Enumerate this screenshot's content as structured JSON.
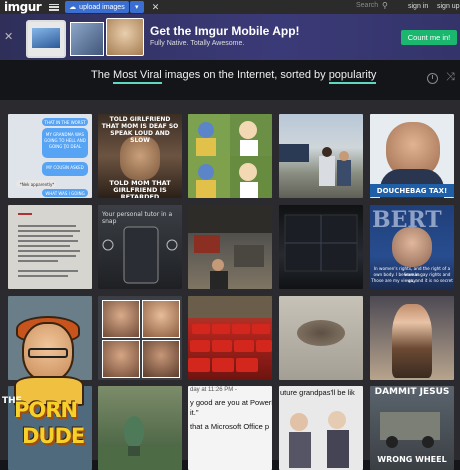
{
  "topbar": {
    "logo": "imgur",
    "upload_label": "upload images",
    "search_label": "Search",
    "signin_label": "sign in",
    "signup_label": "sign up"
  },
  "banner": {
    "title": "Get the Imgur Mobile App!",
    "subtitle": "Fully Native. Totally Awesome.",
    "cta_label": "Count me in!"
  },
  "headline": {
    "prefix": "The",
    "sort_word": "Most Viral",
    "middle": "images on the Internet, sorted by",
    "order_word": "popularity"
  },
  "tiles": {
    "t11_lines": [
      "THAT IN THE WORST",
      "WAY POSSIBLE",
      "MY GRANDMA WAS",
      "SAYING HOW SHE'S",
      "GOING TO HELL AND I",
      "SAID YOU WERE",
      "GOING TO DEAL",
      "WITH IT I STARTED",
      "TO LEAVE",
      "MY COUSIN ASKED",
      "WHERE I WAS GOING",
      "*Nek apparently*",
      "WHAT WAS I GOING"
    ],
    "t12_top": "TOLD GIRLFRIEND THAT MOM IS DEAF SO SPEAK LOUD AND SLOW",
    "t12_bottom": "TOLD MOM THAT GIRLFRIEND IS RETARDED",
    "t15_caption": "DOUCHEBAG TAX!",
    "t22_text": "Your personal tutor in a snap",
    "t25_letters": "BERT",
    "t25_caption_1": "In women's rights, and the right of a woman",
    "t25_caption_2": "own body. I believe in gay rights and gay",
    "t25_caption_3": "Those are my views, and it is no secret",
    "t43_text_1": "y good are you at PowerP",
    "t43_text_2": "it.\"",
    "t43_text_3": "that a Microsoft Office p",
    "t43_time": "day at 11:26 PM -",
    "t44_text_1": "uture grandpas'll be lik",
    "t45_top": "DAMMIT JESUS",
    "t45_bottom": "WRONG WHEEL"
  },
  "ad": {
    "line1": "THE",
    "line2": "PORN",
    "line3": "DUDE"
  },
  "colors": {
    "brand_green": "#1bb76e",
    "upload_blue": "#3a6fd1",
    "accent_teal": "#5fd7c3",
    "banner_bg": "#3b3a78"
  },
  "icons": [
    "menu-icon",
    "cloud-upload-icon",
    "chevron-down-icon",
    "random-icon",
    "search-icon",
    "close-icon",
    "clock-icon",
    "shuffle-icon"
  ]
}
